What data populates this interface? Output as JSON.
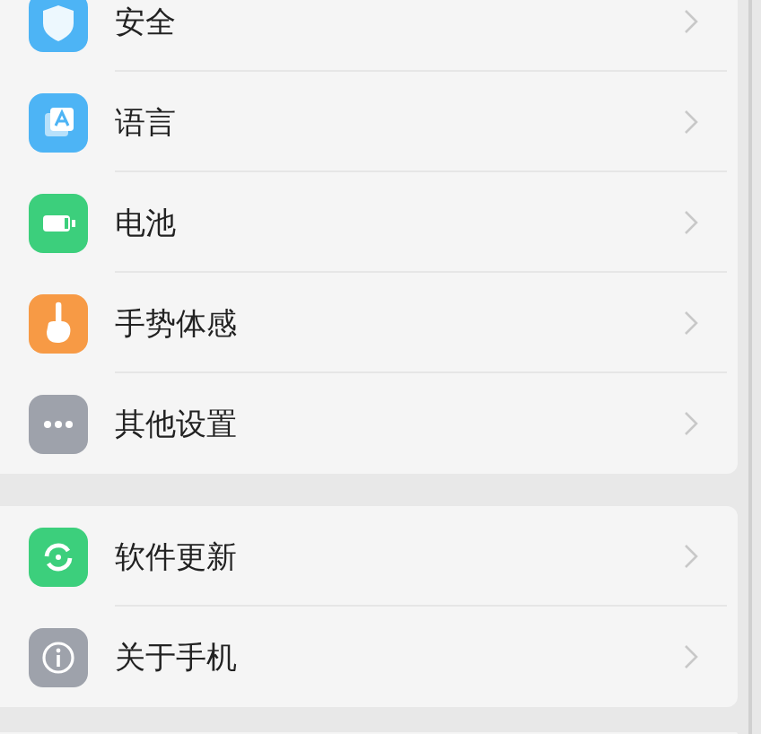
{
  "groups": [
    {
      "items": [
        {
          "label": "安全",
          "color": "#4db4f5"
        },
        {
          "label": "语言",
          "color": "#4db4f5"
        },
        {
          "label": "电池",
          "color": "#3ccf7c"
        },
        {
          "label": "手势体感",
          "color": "#f79a45"
        },
        {
          "label": "其他设置",
          "color": "#9ea2ab"
        }
      ]
    },
    {
      "items": [
        {
          "label": "软件更新",
          "color": "#3ccf7c"
        },
        {
          "label": "关于手机",
          "color": "#9ea2ab"
        }
      ]
    }
  ]
}
